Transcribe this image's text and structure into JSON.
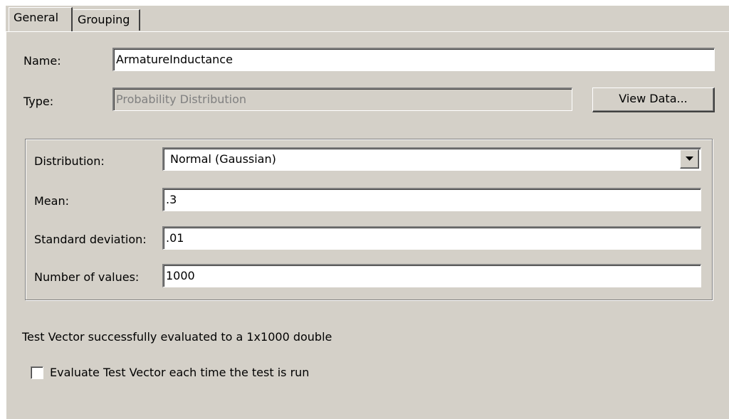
{
  "tabs": [
    {
      "label": "General",
      "active": true
    },
    {
      "label": "Grouping",
      "active": false
    }
  ],
  "general": {
    "name_label": "Name:",
    "name_value": "ArmatureInductance",
    "type_label": "Type:",
    "type_value": "Probability Distribution",
    "view_data_button": "View Data..."
  },
  "distribution_group": {
    "distribution_label": "Distribution:",
    "distribution_value": "Normal (Gaussian)",
    "mean_label": "Mean:",
    "mean_value": ".3",
    "std_label": "Standard deviation:",
    "std_value": ".01",
    "count_label": "Number of values:",
    "count_value": "1000"
  },
  "status_text": "Test Vector successfully evaluated to a 1x1000 double",
  "evaluate_checkbox": {
    "label": "Evaluate Test Vector each time the test is run",
    "checked": false
  },
  "colors": {
    "face": "#d4d0c8",
    "shadow": "#808080",
    "dark_shadow": "#404040",
    "highlight": "#ffffff",
    "disabled_text": "#808080"
  },
  "icons": {
    "dropdown": "chevron-down-icon"
  }
}
